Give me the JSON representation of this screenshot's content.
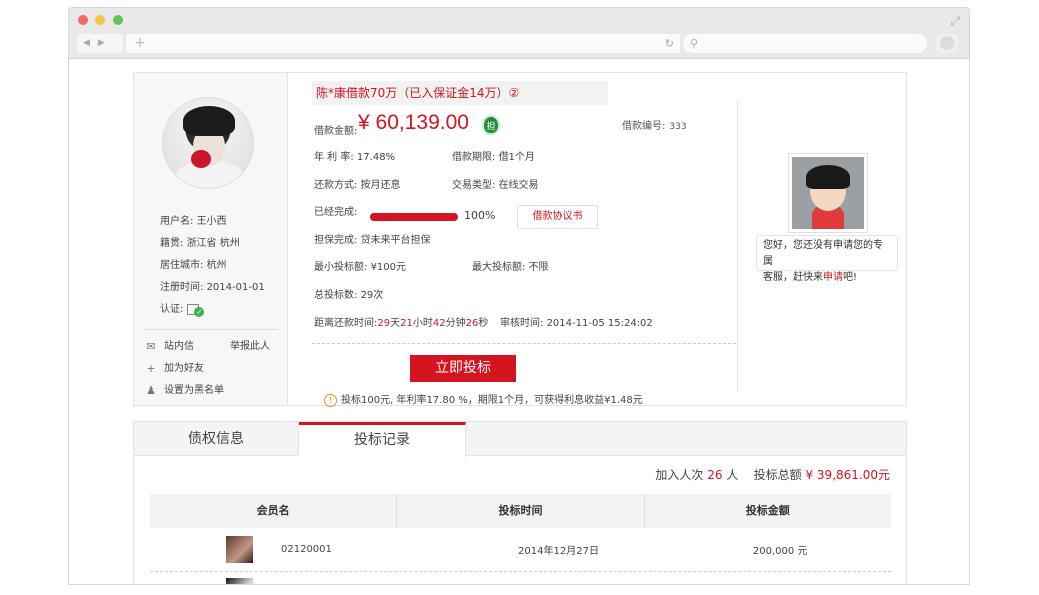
{
  "loan": {
    "title": "陈*康借款70万（已入保证金14万）②",
    "amount_label": "借款金额:",
    "amount": "¥ 60,139.00",
    "badge": "担",
    "loan_no_label": "借款编号:",
    "loan_no": "333",
    "rate_label": "年 利 率:",
    "rate": "17.48%",
    "term_label": "借款期限:",
    "term": "借1个月",
    "repay_label": "还款方式:",
    "repay": "按月还息",
    "trade_label": "交易类型:",
    "trade": "在线交易",
    "done_label": "已经完成:",
    "progress": 100,
    "progress_text": "100%",
    "agreement_button": "借款协议书",
    "guarantee_label": "担保完成:",
    "guarantee": "贷未来平台担保",
    "min_bid_label": "最小投标额:",
    "min_bid": "¥100元",
    "max_bid_label": "最大投标额:",
    "max_bid": "不限",
    "bid_count_label": "总投标数:",
    "bid_count": "29次",
    "countdown_label": "距离还款时间:",
    "cd_days": "29",
    "cd_days_unit": "天",
    "cd_hours": "21",
    "cd_hours_unit": "小时",
    "cd_minutes": "42",
    "cd_minutes_unit": "分钟",
    "cd_seconds": "26",
    "cd_seconds_unit": "秒",
    "review_label": "审核时间:",
    "review_time": "2014-11-05 15:24:02",
    "bid_button": "立即投标",
    "hint_icon": "!",
    "hint": "投标100元, 年利率17.80 %，期限1个月，可获得利息收益¥1.48元"
  },
  "user": {
    "username_label": "用户名:",
    "username": "王小西",
    "native_label": "籍贯:",
    "native": "浙江省 杭州",
    "city_label": "居住城市:",
    "city": "杭州",
    "register_label": "注册时间:",
    "register": "2014-01-01",
    "verify_label": "认证:",
    "actions": {
      "message": "站内信",
      "report": "举报此人",
      "add_friend": "加为好友",
      "blacklist": "设置为黑名单"
    }
  },
  "service": {
    "line1": "您好，您还没有申请您的专属",
    "line2_pre": "客服，赶快来",
    "line2_link": "申请",
    "line2_post": "吧!"
  },
  "tabs": [
    {
      "label": "债权信息",
      "active": false
    },
    {
      "label": "投标记录",
      "active": true
    }
  ],
  "summary": {
    "count_label": "加入人次",
    "count": "26",
    "count_unit": "人",
    "total_label": "投标总额",
    "total": "¥ 39,861.00元"
  },
  "table": {
    "headers": [
      "会员名",
      "投标时间",
      "投标金额"
    ],
    "rows": [
      {
        "member": "02120001",
        "time": "2014年12月27日",
        "amount": "200,000 元"
      }
    ]
  },
  "colors": {
    "accent": "#d4141f",
    "badge": "#1f8f3c"
  }
}
